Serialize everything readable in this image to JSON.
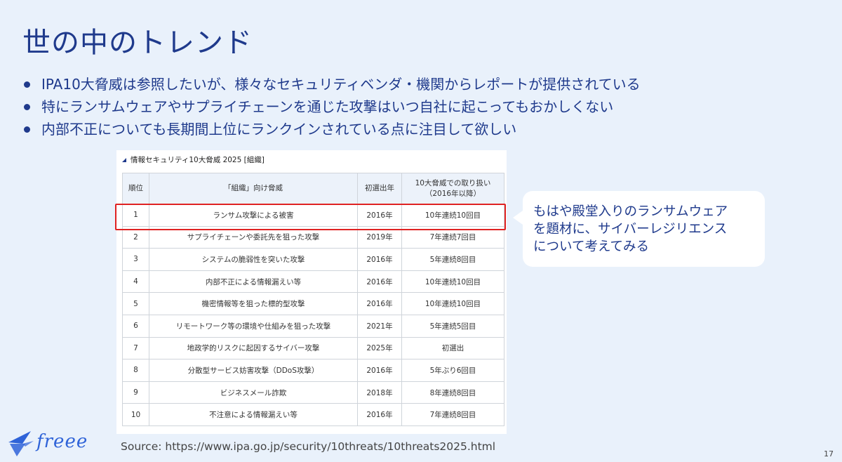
{
  "slide": {
    "title": "世の中のトレンド",
    "bullets": [
      "IPA10大脅威は参照したいが、様々なセキュリティベンダ・機関からレポートが提供されている",
      "特にランサムウェアやサプライチェーンを通じた攻撃はいつ自社に起こってもおかしくない",
      "内部不正についても長期間上位にランクインされている点に注目して欲しい"
    ],
    "page_number": "17"
  },
  "table_panel": {
    "caption": "情報セキュリティ10大脅威 2025 [組織]",
    "headers": {
      "rank": "順位",
      "threat": "「組織」向け脅威",
      "first_year": "初選出年",
      "treatment_line1": "10大脅威での取り扱い",
      "treatment_line2": "（2016年以降）"
    },
    "rows": [
      {
        "rank": "1",
        "threat": "ランサム攻撃による被害",
        "first_year": "2016年",
        "treatment": "10年連続10回目"
      },
      {
        "rank": "2",
        "threat": "サプライチェーンや委託先を狙った攻撃",
        "first_year": "2019年",
        "treatment": "7年連続7回目"
      },
      {
        "rank": "3",
        "threat": "システムの脆弱性を突いた攻撃",
        "first_year": "2016年",
        "treatment": "5年連続8回目"
      },
      {
        "rank": "4",
        "threat": "内部不正による情報漏えい等",
        "first_year": "2016年",
        "treatment": "10年連続10回目"
      },
      {
        "rank": "5",
        "threat": "機密情報等を狙った標的型攻撃",
        "first_year": "2016年",
        "treatment": "10年連続10回目"
      },
      {
        "rank": "6",
        "threat": "リモートワーク等の環境や仕組みを狙った攻撃",
        "first_year": "2021年",
        "treatment": "5年連続5回目"
      },
      {
        "rank": "7",
        "threat": "地政学的リスクに起因するサイバー攻撃",
        "first_year": "2025年",
        "treatment": "初選出"
      },
      {
        "rank": "8",
        "threat": "分散型サービス妨害攻撃（DDoS攻撃）",
        "first_year": "2016年",
        "treatment": "5年ぶり6回目"
      },
      {
        "rank": "9",
        "threat": "ビジネスメール詐欺",
        "first_year": "2018年",
        "treatment": "8年連続8回目"
      },
      {
        "rank": "10",
        "threat": "不注意による情報漏えい等",
        "first_year": "2016年",
        "treatment": "7年連続8回目"
      }
    ]
  },
  "callout": {
    "text": "もはや殿堂入りのランサムウェア\nを題材に、サイバーレジリエンス\nについて考えてみる"
  },
  "footer": {
    "logo_text": "freee",
    "source": "Source: https://www.ipa.go.jp/security/10threats/10threats2025.html"
  },
  "colors": {
    "background": "#e9f1fb",
    "text_primary": "#1f3a8c",
    "highlight_border": "#e02222",
    "table_header_bg": "#ecf2fa",
    "logo": "#2f63d8"
  },
  "icons": {
    "bullet": "filled-circle",
    "caption_marker": "triangle",
    "logo_mark": "bird-icon"
  }
}
